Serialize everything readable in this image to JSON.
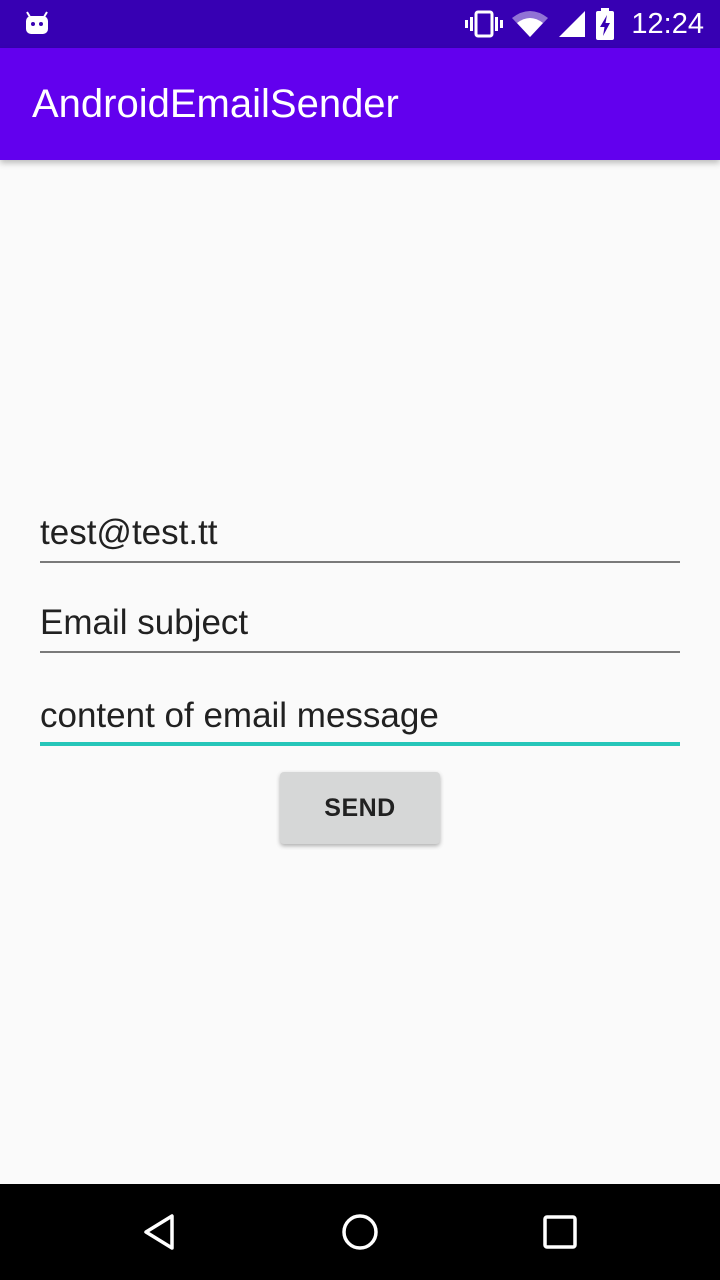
{
  "status_bar": {
    "time": "12:24",
    "icons": [
      "android-notification-icon",
      "vibrate-icon",
      "wifi-icon",
      "cell-signal-icon",
      "battery-charging-icon"
    ]
  },
  "app_bar": {
    "title": "AndroidEmailSender"
  },
  "form": {
    "email_value": "test@test.tt",
    "subject_value": "Email subject",
    "message_value": "content of email message",
    "send_label": "SEND"
  },
  "nav_bar": {
    "icons": [
      "back-icon",
      "home-icon",
      "recents-icon"
    ]
  },
  "colors": {
    "status_bar": "#3700b3",
    "app_bar": "#6200ee",
    "focus_accent": "#26c6b9",
    "background": "#fafafa",
    "button": "#d6d7d7"
  }
}
